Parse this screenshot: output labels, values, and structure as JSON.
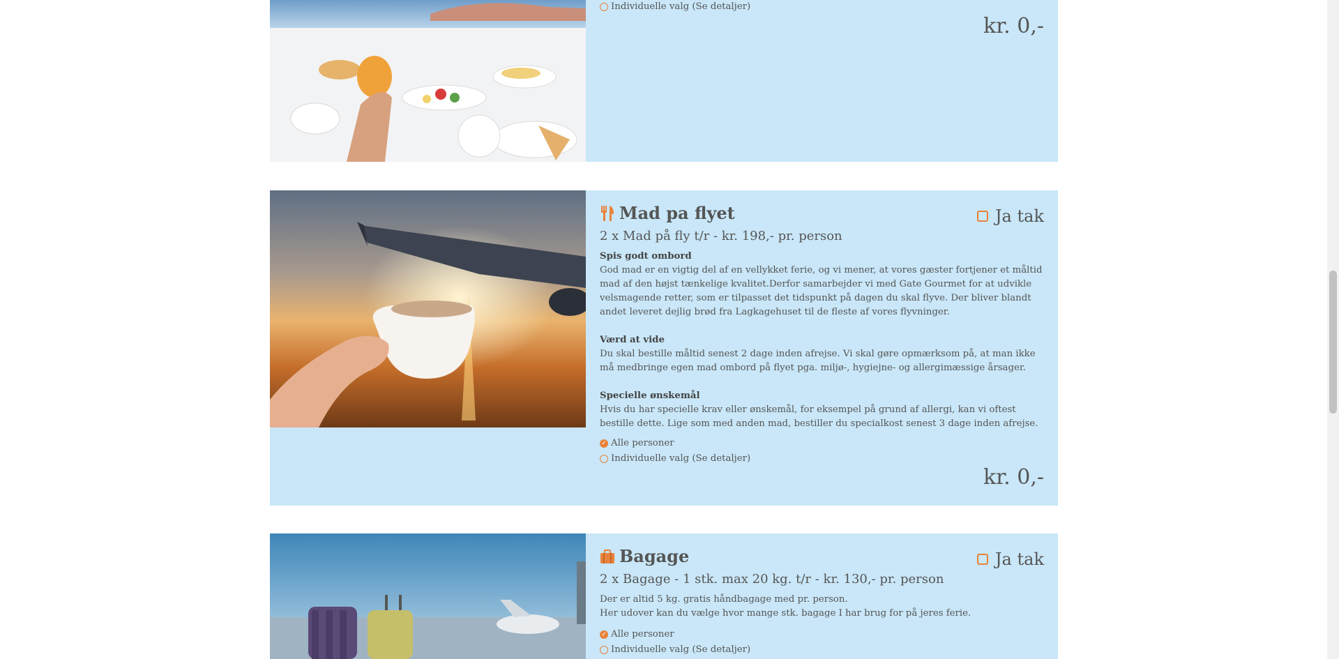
{
  "card_top": {
    "option_individual": "Individuelle valg (Se detaljer)",
    "price": "kr. 0,-"
  },
  "card_mad": {
    "title": "Mad pa flyet",
    "icon": "fork-knife-icon",
    "ja_tak": "Ja tak",
    "subtitle": "2 x Mad på fly t/r - kr. 198,- pr. person",
    "sections": [
      {
        "heading": "Spis godt ombord",
        "text": "God mad er en vigtig del af en vellykket ferie, og vi mener, at vores gæster fortjener et måltid mad af den højst tænkelige kvalitet.Derfor samarbejder vi med Gate Gourmet for at udvikle velsmagende retter, som er tilpasset det tidspunkt på dagen du skal flyve. Der bliver blandt andet leveret dejlig brød fra Lagkagehuset til de fleste af vores flyvninger."
      },
      {
        "heading": "Værd at vide",
        "text": "Du skal bestille måltid senest 2 dage inden afrejse. Vi skal gøre opmærksom på, at man ikke må medbringe egen mad ombord på flyet pga. miljø-, hygiejne- og allergimæssige årsager."
      },
      {
        "heading": "Specielle ønskemål",
        "text": "Hvis du har specielle krav eller ønskemål, for eksempel på grund af allergi, kan vi oftest bestille dette. Lige som med anden mad, bestiller du specialkost senest 3 dage inden afrejse."
      }
    ],
    "option_all": "Alle personer",
    "option_individual": "Individuelle valg (Se detaljer)",
    "price": "kr. 0,-"
  },
  "card_bagage": {
    "title": "Bagage",
    "icon": "suitcase-icon",
    "ja_tak": "Ja tak",
    "subtitle": "2 x Bagage - 1 stk. max 20 kg. t/r - kr. 130,- pr. person",
    "line1": "Der er altid 5 kg. gratis håndbagage med pr. person.",
    "line2": "Her udover kan du vælge hvor mange stk. bagage I har brug for på jeres ferie.",
    "option_all": "Alle personer",
    "option_individual": "Individuelle valg (Se detaljer)"
  },
  "colors": {
    "card_bg": "#c9e7f8",
    "accent": "#e8823a",
    "text": "#555555"
  }
}
